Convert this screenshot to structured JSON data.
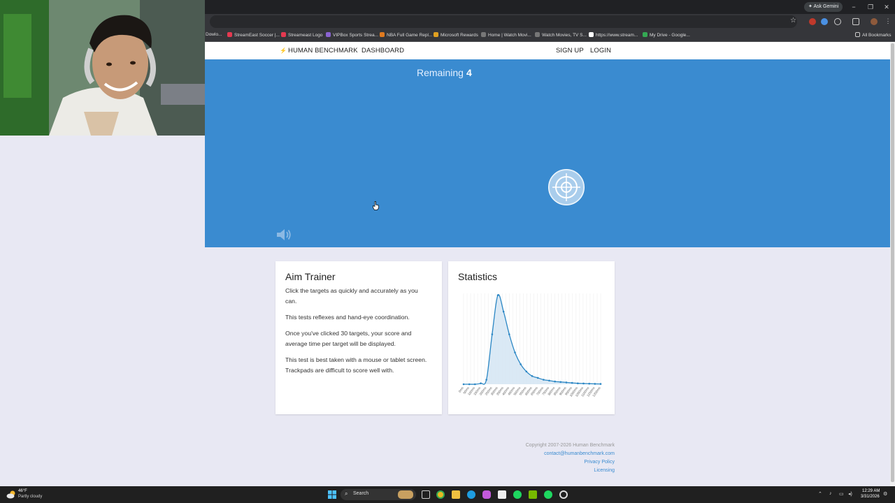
{
  "browser": {
    "gemini_label": "Ask Gemini",
    "bookmarks": [
      {
        "label": "Dowlo...",
        "color": "#5f6368"
      },
      {
        "label": "StreamEast Soccer |...",
        "color": "#e53950"
      },
      {
        "label": "Streameast Logo",
        "color": "#e53950"
      },
      {
        "label": "VIPBox Sports Strea...",
        "color": "#8a63d2"
      },
      {
        "label": "NBA Full Game Repl...",
        "color": "#e07a1f"
      },
      {
        "label": "Microsoft Rewards",
        "color": "#e0a020"
      },
      {
        "label": "Home | Watch Movi...",
        "color": "#777"
      },
      {
        "label": "Watch Movies, TV S...",
        "color": "#777"
      },
      {
        "label": "https://www.stream...",
        "color": "#ffffff"
      },
      {
        "label": "My Drive - Google...",
        "color": "#34a853"
      }
    ],
    "all_bookmarks": "All Bookmarks"
  },
  "nav": {
    "brand": "HUMAN BENCHMARK",
    "dashboard": "DASHBOARD",
    "signup": "SIGN UP",
    "login": "LOGIN"
  },
  "game": {
    "remaining_label": "Remaining",
    "remaining_count": "4"
  },
  "about": {
    "title": "Aim Trainer",
    "paragraphs": [
      "Click the targets as quickly and accurately as you can.",
      "This tests reflexes and hand-eye coordination.",
      "Once you've clicked 30 targets, your score and average time per target will be displayed.",
      "This test is best taken with a mouse or tablet screen. Trackpads are difficult to score well with."
    ]
  },
  "stats": {
    "title": "Statistics"
  },
  "chart_data": {
    "type": "area",
    "title": "",
    "xlabel": "",
    "ylabel": "",
    "x": [
      "0ms",
      "50ms",
      "100ms",
      "150ms",
      "200ms",
      "250ms",
      "300ms",
      "350ms",
      "400ms",
      "450ms",
      "500ms",
      "550ms",
      "600ms",
      "650ms",
      "700ms",
      "750ms",
      "800ms",
      "850ms",
      "900ms",
      "950ms",
      "1000ms",
      "1050ms",
      "1100ms",
      "1150ms",
      "1200ms"
    ],
    "y": [
      0.0,
      0.0,
      0.0,
      0.01,
      0.05,
      0.55,
      0.98,
      0.8,
      0.55,
      0.35,
      0.22,
      0.14,
      0.09,
      0.07,
      0.05,
      0.04,
      0.03,
      0.025,
      0.02,
      0.015,
      0.01,
      0.008,
      0.006,
      0.004,
      0.003
    ],
    "grid": true,
    "legend": "none",
    "color": "#2a86c4"
  },
  "footer": {
    "copyright": "Copyright 2007-2026 Human Benchmark",
    "email": "contact@humanbenchmark.com",
    "privacy": "Privacy Policy",
    "licensing": "Licensing"
  },
  "taskbar": {
    "weather_temp": "46°F",
    "weather_desc": "Partly cloudy",
    "search_label": "Search",
    "time": "12:29 AM",
    "date": "3/31/2026"
  },
  "colors": {
    "hero": "#3a8bd0",
    "page_bg": "#e8e8f3",
    "link": "#3a8bd0"
  }
}
